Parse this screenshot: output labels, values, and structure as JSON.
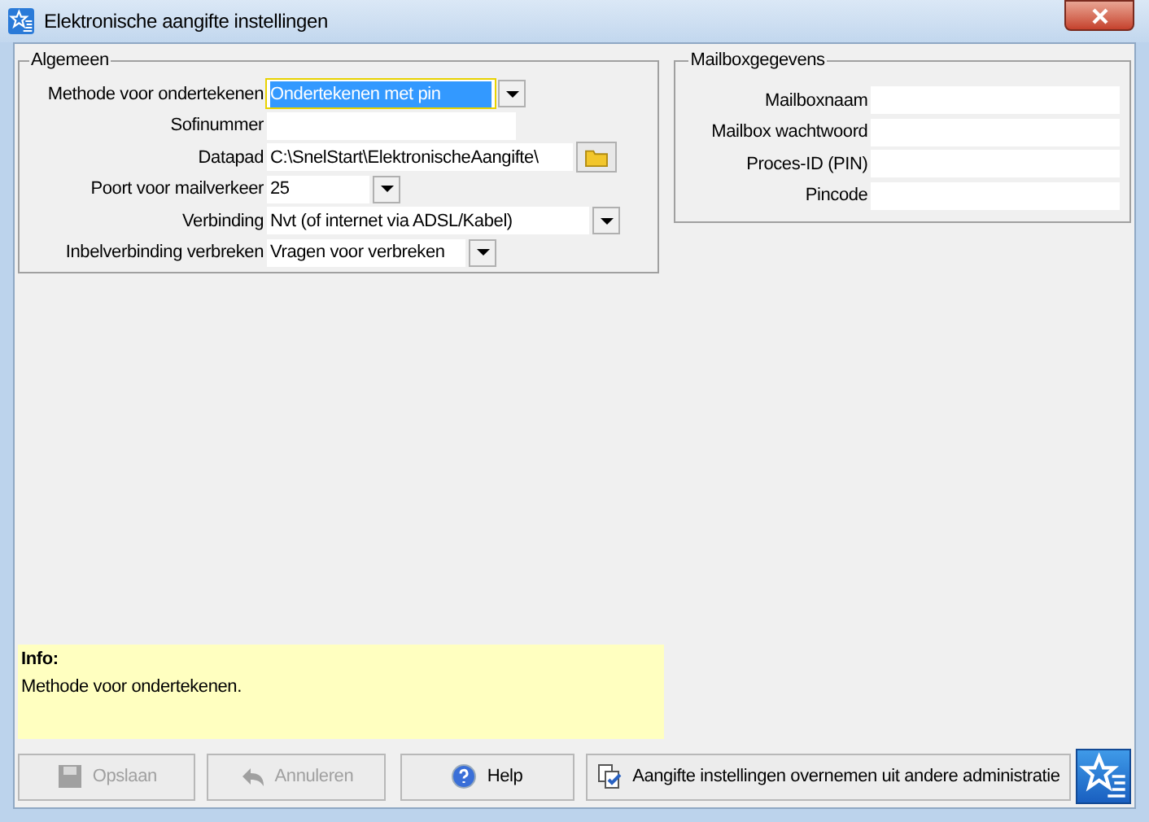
{
  "window": {
    "title": "Elektronische aangifte instellingen"
  },
  "general": {
    "title": "Algemeen",
    "fields": [
      {
        "label": "Methode voor ondertekenen",
        "kind": "combo",
        "value": "Ondertekenen met pin",
        "selected": true
      },
      {
        "label": "Sofinummer",
        "kind": "text",
        "selected": false
      },
      {
        "label": "Datapad",
        "kind": "path",
        "value": "C:\\SnelStart\\ElektronischeAangifte\\",
        "selected": false
      },
      {
        "label": "Poort voor mailverkeer",
        "kind": "combo",
        "value": "25",
        "selected": false
      },
      {
        "label": "Verbinding",
        "kind": "combo",
        "value": "Nvt (of internet via ADSL/Kabel)",
        "selected": false
      },
      {
        "label": "Inbelverbinding verbreken",
        "kind": "combo",
        "value": "Vragen voor verbreken",
        "selected": false
      }
    ]
  },
  "mailbox": {
    "title": "Mailboxgegevens",
    "fields": [
      {
        "label": "Mailboxnaam"
      },
      {
        "label": "Mailbox wachtwoord"
      },
      {
        "label": "Proces-ID (PIN)"
      },
      {
        "label": "Pincode"
      }
    ]
  },
  "info": {
    "title": "Info:",
    "text": "Methode voor ondertekenen."
  },
  "buttons": [
    {
      "label": "Opslaan",
      "kind": "save",
      "disabled": true
    },
    {
      "label": "Annuleren",
      "kind": "undo",
      "disabled": true
    },
    {
      "label": "Help",
      "kind": "help",
      "disabled": false
    },
    {
      "label": "Aangifte instellingen overnemen uit andere administratie",
      "kind": "copy",
      "disabled": false
    }
  ]
}
